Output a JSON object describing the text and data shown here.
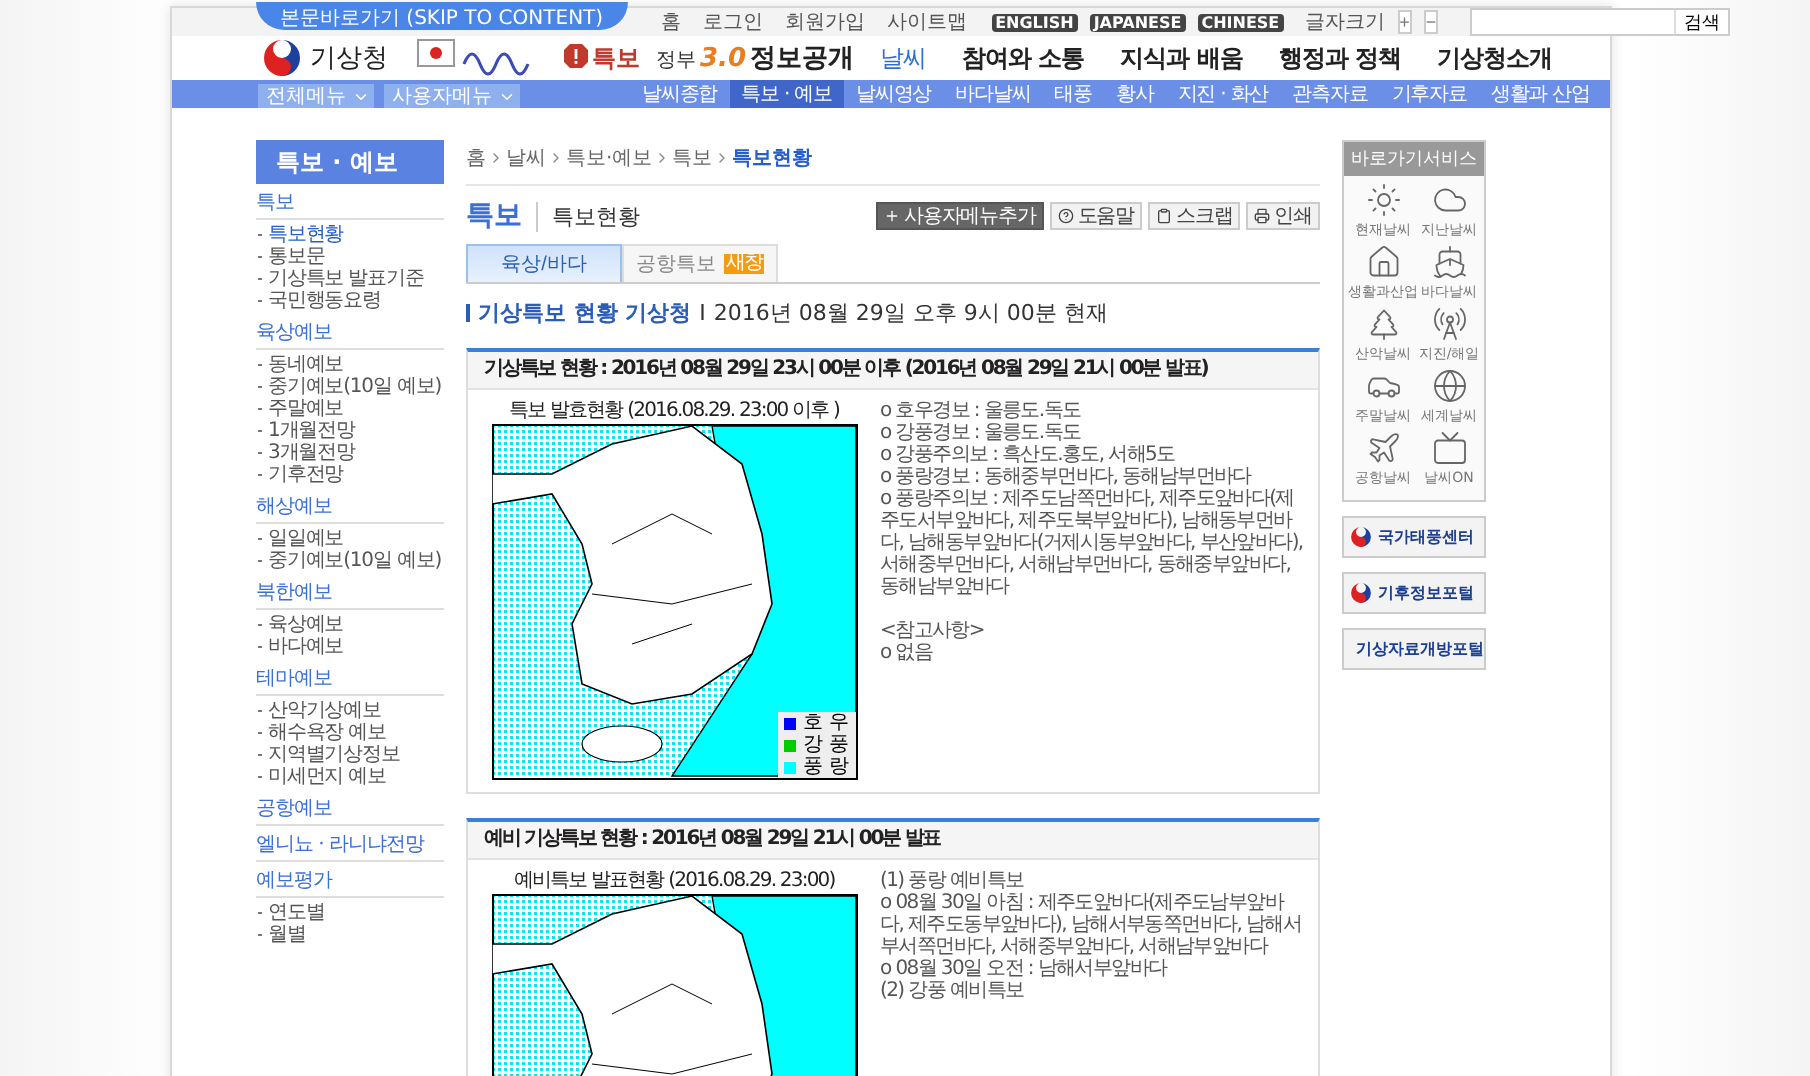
{
  "skip_link": "본문바로가기 (SKIP TO CONTENT)",
  "util_links": [
    "홈",
    "로그인",
    "회원가입",
    "사이트맵"
  ],
  "languages": [
    "ENGLISH",
    "JAPANESE",
    "CHINESE"
  ],
  "font_size": {
    "label": "글자크기",
    "plus": "+",
    "minus": "−"
  },
  "search": {
    "button": "검색"
  },
  "logo": {
    "name": "기상청"
  },
  "alert_badge": "특보",
  "gov30": {
    "prefix": "정부",
    "mark": "3.0",
    "label": "정보공개"
  },
  "main_menu": [
    {
      "label": "날씨",
      "selected": true
    },
    {
      "label": "참여와 소통",
      "selected": false
    },
    {
      "label": "지식과 배움",
      "selected": false
    },
    {
      "label": "행정과 정책",
      "selected": false
    },
    {
      "label": "기상청소개",
      "selected": false
    }
  ],
  "menu_dropdowns": [
    "전체메뉴",
    "사용자메뉴"
  ],
  "sub_menu": [
    {
      "label": "날씨종합",
      "selected": false
    },
    {
      "label": "특보 · 예보",
      "selected": true
    },
    {
      "label": "날씨영상",
      "selected": false
    },
    {
      "label": "바다날씨",
      "selected": false
    },
    {
      "label": "태풍",
      "selected": false
    },
    {
      "label": "황사",
      "selected": false
    },
    {
      "label": "지진 · 화산",
      "selected": false
    },
    {
      "label": "관측자료",
      "selected": false
    },
    {
      "label": "기후자료",
      "selected": false
    },
    {
      "label": "생활과 산업",
      "selected": false
    }
  ],
  "sidebar": {
    "title": "특보 · 예보",
    "groups": [
      {
        "title": "특보",
        "items": [
          {
            "label": "특보현황",
            "selected": true
          },
          {
            "label": "통보문",
            "selected": false
          },
          {
            "label": "기상특보 발표기준",
            "selected": false
          },
          {
            "label": "국민행동요령",
            "selected": false
          }
        ]
      },
      {
        "title": "육상예보",
        "items": [
          {
            "label": "동네예보",
            "selected": false
          },
          {
            "label": "중기예보(10일 예보)",
            "selected": false
          },
          {
            "label": "주말예보",
            "selected": false
          },
          {
            "label": "1개월전망",
            "selected": false
          },
          {
            "label": "3개월전망",
            "selected": false
          },
          {
            "label": "기후전망",
            "selected": false
          }
        ]
      },
      {
        "title": "해상예보",
        "items": [
          {
            "label": "일일예보",
            "selected": false
          },
          {
            "label": "중기예보(10일 예보)",
            "selected": false
          }
        ]
      },
      {
        "title": "북한예보",
        "items": [
          {
            "label": "육상예보",
            "selected": false
          },
          {
            "label": "바다예보",
            "selected": false
          }
        ]
      },
      {
        "title": "테마예보",
        "items": [
          {
            "label": "산악기상예보",
            "selected": false
          },
          {
            "label": "해수욕장 예보",
            "selected": false
          },
          {
            "label": "지역별기상정보",
            "selected": false
          },
          {
            "label": "미세먼지 예보",
            "selected": false
          }
        ]
      },
      {
        "title": "공항예보"
      },
      {
        "title": "엘니뇨 · 라니냐전망"
      },
      {
        "title": "예보평가",
        "items": [
          {
            "label": "연도별",
            "selected": false
          },
          {
            "label": "월별",
            "selected": false
          }
        ]
      }
    ]
  },
  "breadcrumb": [
    "홈",
    "날씨",
    "특보·예보",
    "특보",
    "특보현황"
  ],
  "page_title": {
    "section": "특보",
    "page": "특보현황"
  },
  "tools": [
    {
      "label": "사용자메뉴추가",
      "kind": "primary"
    },
    {
      "label": "도움말",
      "kind": "help"
    },
    {
      "label": "스크랩",
      "kind": "scrap"
    },
    {
      "label": "인쇄",
      "kind": "print"
    }
  ],
  "tabs": [
    {
      "label": "육상/바다",
      "selected": true
    },
    {
      "label": "공항특보",
      "selected": false,
      "badge": "새창"
    }
  ],
  "status_heading": {
    "title": "기상특보 현황 기상청",
    "separator": "I",
    "time": "2016년 08월 29일 오후 9시 00분 현재"
  },
  "panels": [
    {
      "title": "기상특보 현황 : 2016년 08월 29일 23시 00분 이후 (2016년 08월 29일 21시 00분 발표)",
      "map_caption": "특보 발효현황 (2016.08.29. 23:00 이후 )",
      "legend": [
        {
          "label": "호 우",
          "color": "#0000ff"
        },
        {
          "label": "강 풍",
          "color": "#00cc00"
        },
        {
          "label": "풍 랑",
          "color": "#00ffff"
        }
      ],
      "lines": [
        "o 호우경보 : 울릉도.독도",
        "o 강풍경보 : 울릉도.독도",
        "o 강풍주의보 : 흑산도.홍도, 서해5도",
        "o 풍랑경보 : 동해중부먼바다, 동해남부먼바다",
        "o 풍랑주의보 : 제주도남쪽먼바다, 제주도앞바다(제주도서부앞바다, 제주도북부앞바다), 남해동부먼바다, 남해동부앞바다(거제시동부앞바다, 부산앞바다), 서해중부먼바다, 서해남부먼바다, 동해중부앞바다, 동해남부앞바다"
      ],
      "note": {
        "title": "<참고사항>",
        "text": "o 없음"
      }
    },
    {
      "title": "예비 기상특보 현황 : 2016년 08월 29일 21시 00분 발표",
      "map_caption": "예비특보 발표현황 (2016.08.29. 23:00)",
      "lines": [
        "(1) 풍랑 예비특보",
        "o 08월 30일 아침 : 제주도앞바다(제주도남부앞바다, 제주도동부앞바다), 남해서부동쪽먼바다, 남해서부서쪽먼바다, 서해중부앞바다, 서해남부앞바다",
        "o 08월 30일 오전 : 남해서부앞바다",
        "(2) 강풍 예비특보"
      ]
    }
  ],
  "quick": {
    "title": "바로가기서비스",
    "items": [
      "현재날씨",
      "지난날씨",
      "생활과산업",
      "바다날씨",
      "산악날씨",
      "지진/해일",
      "주말날씨",
      "세계날씨",
      "공항날씨",
      "날씨ON"
    ]
  },
  "banners": [
    "국가태풍센터",
    "기후정보포털",
    "기상자료개방포털"
  ]
}
